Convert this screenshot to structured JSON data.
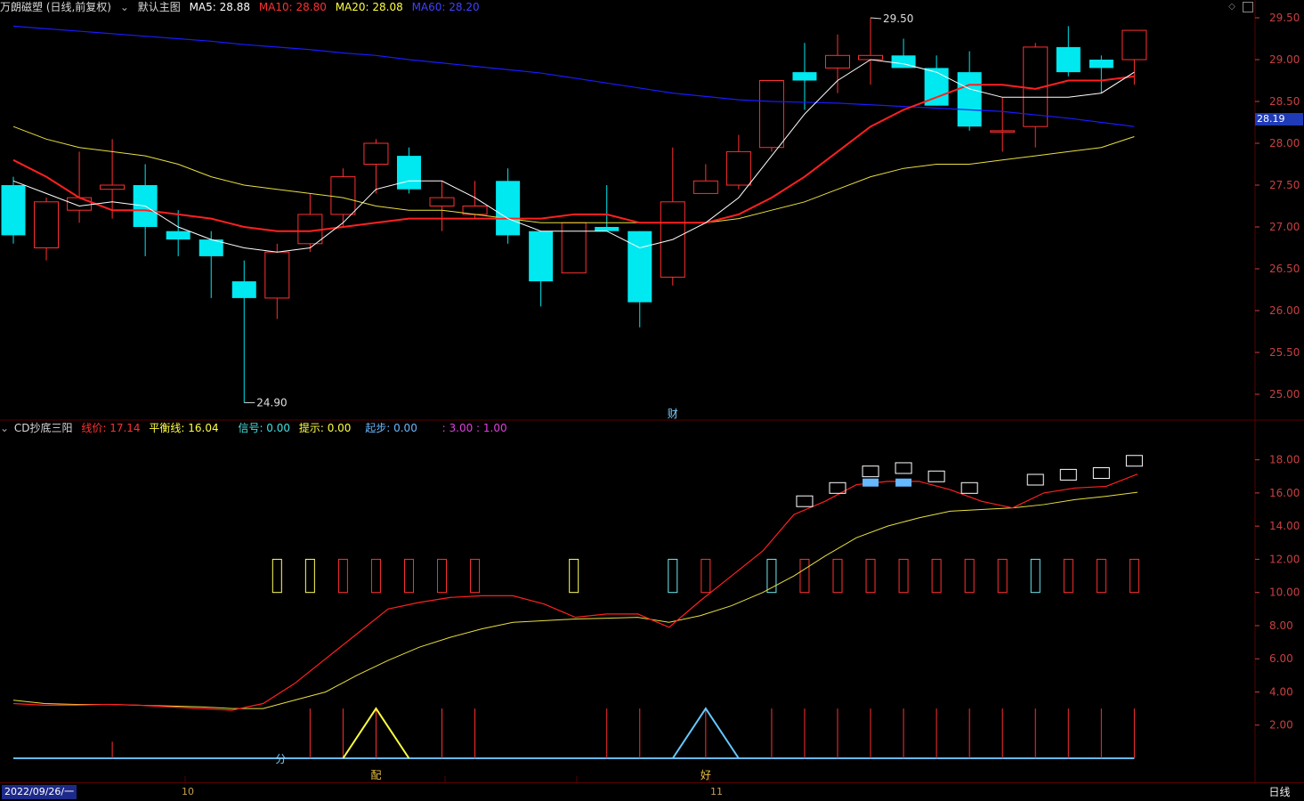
{
  "header_main": {
    "title": "万朗磁塑 (日线,前复权)",
    "template": "默认主图",
    "ma5": "MA5: 28.88",
    "ma10": "MA10: 28.80",
    "ma20": "MA20: 28.08",
    "ma60": "MA60: 28.20",
    "colors": {
      "title": "#d8d8d8",
      "ma5": "#ffffff",
      "ma10": "#ff3030",
      "ma20": "#ffff40",
      "ma60": "#4040ff"
    }
  },
  "header_sub": {
    "title": "CD抄底三阳",
    "xianjia": "线价: 17.14",
    "pinghengxian": "平衡线: 16.04",
    "xinhao": "信号: 0.00",
    "tishi": "提示: 0.00",
    "qibu": "起步: 0.00",
    "ratio": ": 3.00 : 1.00"
  },
  "current_price_tag": "28.19",
  "bottom": {
    "date_label": "2022/09/26/一",
    "month_marks": [
      "10",
      "11"
    ],
    "period_button": "日线"
  },
  "icons": [
    "diamond-icon",
    "settings-square-icon",
    "dropdown-circle-icon"
  ],
  "colors": {
    "up": "#ff3030",
    "down": "#00e8f0",
    "ma5": "#ffffff",
    "ma10": "#ff2020",
    "ma20": "#e8e040",
    "ma60": "#1a1aff",
    "grid": "#5a0000",
    "axis_text": "#c84040"
  },
  "chart_data": [
    {
      "type": "candlestick",
      "yticks": [
        29.5,
        29.0,
        28.5,
        28.0,
        27.5,
        27.0,
        26.5,
        26.0,
        25.5,
        25.0
      ],
      "ylim": [
        24.85,
        29.75
      ],
      "annotations": [
        {
          "text": "29.50",
          "index": 26
        },
        {
          "text": "24.90",
          "index": 7
        },
        {
          "text": "财",
          "index": 20
        }
      ],
      "candles": [
        {
          "o": 27.5,
          "h": 27.6,
          "l": 26.8,
          "c": 26.9
        },
        {
          "o": 26.75,
          "h": 27.35,
          "l": 26.6,
          "c": 27.3
        },
        {
          "o": 27.2,
          "h": 27.9,
          "l": 27.05,
          "c": 27.35
        },
        {
          "o": 27.45,
          "h": 28.05,
          "l": 27.1,
          "c": 27.5
        },
        {
          "o": 27.5,
          "h": 27.75,
          "l": 26.65,
          "c": 27.0
        },
        {
          "o": 26.95,
          "h": 27.2,
          "l": 26.65,
          "c": 26.85
        },
        {
          "o": 26.85,
          "h": 26.95,
          "l": 26.15,
          "c": 26.65
        },
        {
          "o": 26.35,
          "h": 26.6,
          "l": 24.9,
          "c": 26.15
        },
        {
          "o": 26.15,
          "h": 26.8,
          "l": 25.9,
          "c": 26.7
        },
        {
          "o": 26.8,
          "h": 27.4,
          "l": 26.7,
          "c": 27.15
        },
        {
          "o": 27.15,
          "h": 27.7,
          "l": 27.0,
          "c": 27.6
        },
        {
          "o": 27.75,
          "h": 28.05,
          "l": 27.4,
          "c": 28.0
        },
        {
          "o": 27.85,
          "h": 27.95,
          "l": 27.4,
          "c": 27.45
        },
        {
          "o": 27.25,
          "h": 27.55,
          "l": 26.95,
          "c": 27.35
        },
        {
          "o": 27.15,
          "h": 27.55,
          "l": 27.1,
          "c": 27.25
        },
        {
          "o": 27.55,
          "h": 27.7,
          "l": 26.8,
          "c": 26.9
        },
        {
          "o": 26.95,
          "h": 26.95,
          "l": 26.05,
          "c": 26.35
        },
        {
          "o": 26.45,
          "h": 27.05,
          "l": 26.45,
          "c": 27.05
        },
        {
          "o": 27.0,
          "h": 27.5,
          "l": 26.95,
          "c": 26.95
        },
        {
          "o": 26.95,
          "h": 26.95,
          "l": 25.8,
          "c": 26.1
        },
        {
          "o": 26.4,
          "h": 27.95,
          "l": 26.3,
          "c": 27.3
        },
        {
          "o": 27.4,
          "h": 27.75,
          "l": 27.4,
          "c": 27.55
        },
        {
          "o": 27.5,
          "h": 28.1,
          "l": 27.45,
          "c": 27.9
        },
        {
          "o": 27.95,
          "h": 28.75,
          "l": 27.9,
          "c": 28.75
        },
        {
          "o": 28.85,
          "h": 29.2,
          "l": 28.4,
          "c": 28.75
        },
        {
          "o": 28.9,
          "h": 29.3,
          "l": 28.6,
          "c": 29.05
        },
        {
          "o": 29.0,
          "h": 29.5,
          "l": 28.7,
          "c": 29.05
        },
        {
          "o": 29.05,
          "h": 29.25,
          "l": 28.9,
          "c": 28.9
        },
        {
          "o": 28.9,
          "h": 29.05,
          "l": 28.45,
          "c": 28.45
        },
        {
          "o": 28.85,
          "h": 29.1,
          "l": 28.15,
          "c": 28.2
        },
        {
          "o": 28.15,
          "h": 28.55,
          "l": 27.9,
          "c": 28.15
        },
        {
          "o": 28.2,
          "h": 29.2,
          "l": 27.95,
          "c": 29.15
        },
        {
          "o": 29.15,
          "h": 29.4,
          "l": 28.8,
          "c": 28.85
        },
        {
          "o": 29.0,
          "h": 29.05,
          "l": 28.6,
          "c": 28.9
        },
        {
          "o": 29.0,
          "h": 29.35,
          "l": 28.7,
          "c": 29.35
        }
      ],
      "ma5": [
        27.55,
        27.4,
        27.25,
        27.3,
        27.25,
        27.0,
        26.85,
        26.75,
        26.7,
        26.75,
        27.05,
        27.45,
        27.55,
        27.55,
        27.35,
        27.1,
        26.95,
        26.95,
        26.95,
        26.75,
        26.85,
        27.05,
        27.35,
        27.85,
        28.35,
        28.75,
        29.0,
        28.95,
        28.85,
        28.65,
        28.55,
        28.55,
        28.55,
        28.6,
        28.85
      ],
      "ma10": [
        27.8,
        27.6,
        27.35,
        27.2,
        27.2,
        27.15,
        27.1,
        27.0,
        26.95,
        26.95,
        27.0,
        27.05,
        27.1,
        27.1,
        27.1,
        27.1,
        27.1,
        27.15,
        27.15,
        27.05,
        27.05,
        27.05,
        27.15,
        27.35,
        27.6,
        27.9,
        28.2,
        28.4,
        28.55,
        28.7,
        28.7,
        28.65,
        28.75,
        28.75,
        28.8
      ],
      "ma20": [
        28.2,
        28.05,
        27.95,
        27.9,
        27.85,
        27.75,
        27.6,
        27.5,
        27.45,
        27.4,
        27.35,
        27.25,
        27.2,
        27.2,
        27.15,
        27.1,
        27.05,
        27.05,
        27.05,
        27.05,
        27.05,
        27.05,
        27.1,
        27.2,
        27.3,
        27.45,
        27.6,
        27.7,
        27.75,
        27.75,
        27.8,
        27.85,
        27.9,
        27.95,
        28.08
      ],
      "ma60": [
        29.4,
        29.37,
        29.34,
        29.31,
        29.28,
        29.25,
        29.22,
        29.18,
        29.15,
        29.12,
        29.08,
        29.05,
        29.0,
        28.96,
        28.92,
        28.88,
        28.84,
        28.78,
        28.72,
        28.66,
        28.6,
        28.56,
        28.52,
        28.5,
        28.49,
        28.48,
        28.46,
        28.44,
        28.42,
        28.4,
        28.38,
        28.34,
        28.3,
        28.25,
        28.2
      ]
    },
    {
      "type": "indicator",
      "name": "CD抄底三阳",
      "yticks": [
        18.0,
        16.0,
        14.0,
        12.0,
        10.0,
        8.0,
        6.0,
        4.0,
        2.0
      ],
      "ylim": [
        -0.5,
        19.0
      ],
      "xianjia": [
        3.3,
        3.2,
        3.2,
        3.25,
        3.2,
        3.1,
        3.0,
        2.9,
        3.3,
        4.5,
        6.0,
        7.5,
        9.0,
        9.4,
        9.7,
        9.8,
        9.8,
        9.3,
        8.5,
        8.7,
        8.7,
        7.9,
        9.5,
        11.0,
        12.5,
        14.7,
        15.5,
        16.5,
        16.7,
        16.7,
        16.2,
        15.5,
        15.1,
        16.0,
        16.3,
        16.4,
        17.14
      ],
      "pinghengxian": [
        3.5,
        3.3,
        3.25,
        3.25,
        3.2,
        3.15,
        3.1,
        3.0,
        3.0,
        3.5,
        4.0,
        5.0,
        5.9,
        6.7,
        7.3,
        7.8,
        8.2,
        8.3,
        8.4,
        8.45,
        8.5,
        8.2,
        8.6,
        9.2,
        10.0,
        11.0,
        12.2,
        13.3,
        14.0,
        14.5,
        14.9,
        15.0,
        15.1,
        15.3,
        15.6,
        15.8,
        16.04
      ],
      "bars_yellow": [
        8,
        9,
        17
      ],
      "bars_cyan": [
        20,
        23,
        31
      ],
      "bars_red": [
        10,
        11,
        12,
        13,
        14,
        21,
        24,
        25,
        26,
        27,
        28,
        29,
        30,
        32,
        33,
        34
      ],
      "white_boxes": [
        24,
        25,
        26,
        27,
        28,
        29,
        31,
        32,
        33,
        34
      ],
      "light_blue_boxes": [
        26,
        27
      ],
      "spike_indices": [
        3,
        9,
        10,
        11,
        13,
        14,
        18,
        19,
        21,
        23,
        24,
        25,
        26,
        27,
        28,
        29,
        30,
        31,
        32,
        33,
        34
      ],
      "triangles": [
        {
          "index": 11,
          "color": "#ffff40"
        },
        {
          "index": 21,
          "color": "#66c8ff"
        }
      ],
      "labels": [
        {
          "text": "分",
          "index": 8
        },
        {
          "text": "配",
          "index": 11
        },
        {
          "text": "好",
          "index": 21
        }
      ]
    }
  ]
}
